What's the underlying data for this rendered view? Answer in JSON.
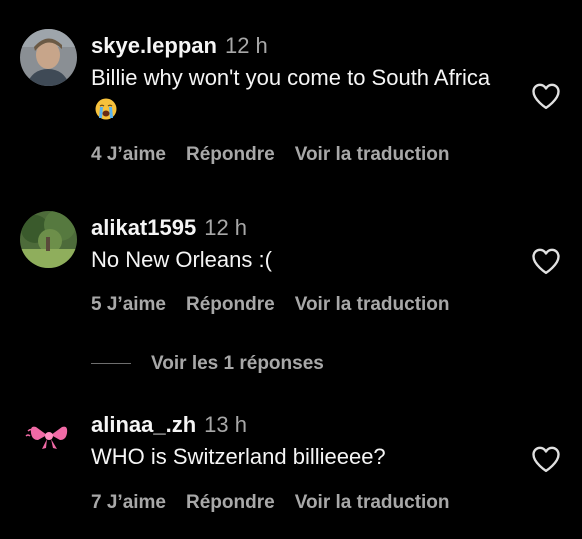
{
  "comments": [
    {
      "username": "skye.leppan",
      "time": "12 h",
      "text": "Billie why won't you come to South Africa",
      "emoji": "loudly-crying-face-emoji",
      "likes": "4 J’aime",
      "reply_label": "Répondre",
      "translate_label": "Voir la traduction",
      "avatar": "profile-photo-icon"
    },
    {
      "username": "alikat1595",
      "time": "12 h",
      "text": "No New Orleans :(",
      "likes": "5 J’aime",
      "reply_label": "Répondre",
      "translate_label": "Voir la traduction",
      "avatar": "profile-photo-icon"
    },
    {
      "username": "alinaa_.zh",
      "time": "13 h",
      "text": "WHO is Switzerland billieeee?",
      "likes": "7 J’aime",
      "reply_label": "Répondre",
      "translate_label": "Voir la traduction",
      "avatar": "pink-bow-icon"
    }
  ],
  "view_replies": "Voir les 1 réponses",
  "icons": {
    "like": "heart-outline-icon"
  },
  "colors": {
    "background": "#000000",
    "primary_text": "#f5f5f5",
    "secondary_text": "#a8a8a8"
  }
}
